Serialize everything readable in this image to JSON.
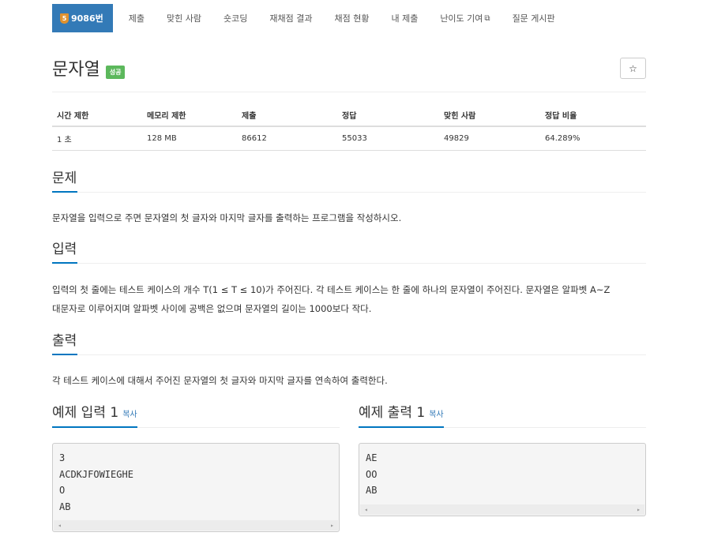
{
  "nav": {
    "problem_badge": "5",
    "items": [
      "9086번",
      "제출",
      "맞힌 사람",
      "숏코딩",
      "재채점 결과",
      "채점 현황",
      "내 제출",
      "난이도 기여",
      "질문 게시판"
    ]
  },
  "problem": {
    "title": "문자열",
    "status": "성공",
    "star": "☆"
  },
  "stats": {
    "headers": [
      "시간 제한",
      "메모리 제한",
      "제출",
      "정답",
      "맞힌 사람",
      "정답 비율"
    ],
    "values": [
      "1 초",
      "128 MB",
      "86612",
      "55033",
      "49829",
      "64.289%"
    ]
  },
  "sections": {
    "problem_title": "문제",
    "problem_text": "문자열을 입력으로 주면 문자열의 첫 글자와 마지막 글자를 출력하는 프로그램을 작성하시오.",
    "input_title": "입력",
    "input_text_1": "입력의 첫 줄에는 테스트 케이스의 개수 T(1 ≤ T ≤ 10)가 주어진다. 각 테스트 케이스는 한 줄에 하나의 문자열이 주어진다. 문자열은 알파벳 A~Z",
    "input_text_2": "대문자로 이루어지며 알파벳 사이에 공백은 없으며 문자열의 길이는 1000보다 작다.",
    "output_title": "출력",
    "output_text": "각 테스트 케이스에 대해서 주어진 문자열의 첫 글자와 마지막 글자를 연속하여 출력한다."
  },
  "examples": {
    "input_title": "예제 입력 1",
    "output_title": "예제 출력 1",
    "copy_label": "복사",
    "input_lines": [
      "3",
      "ACDKJFOWIEGHE",
      "O",
      "AB"
    ],
    "output_lines": [
      "AE",
      "OO",
      "AB"
    ]
  },
  "icons": {
    "external": "external-link-icon",
    "scroll_left": "◂",
    "scroll_right": "▸"
  }
}
